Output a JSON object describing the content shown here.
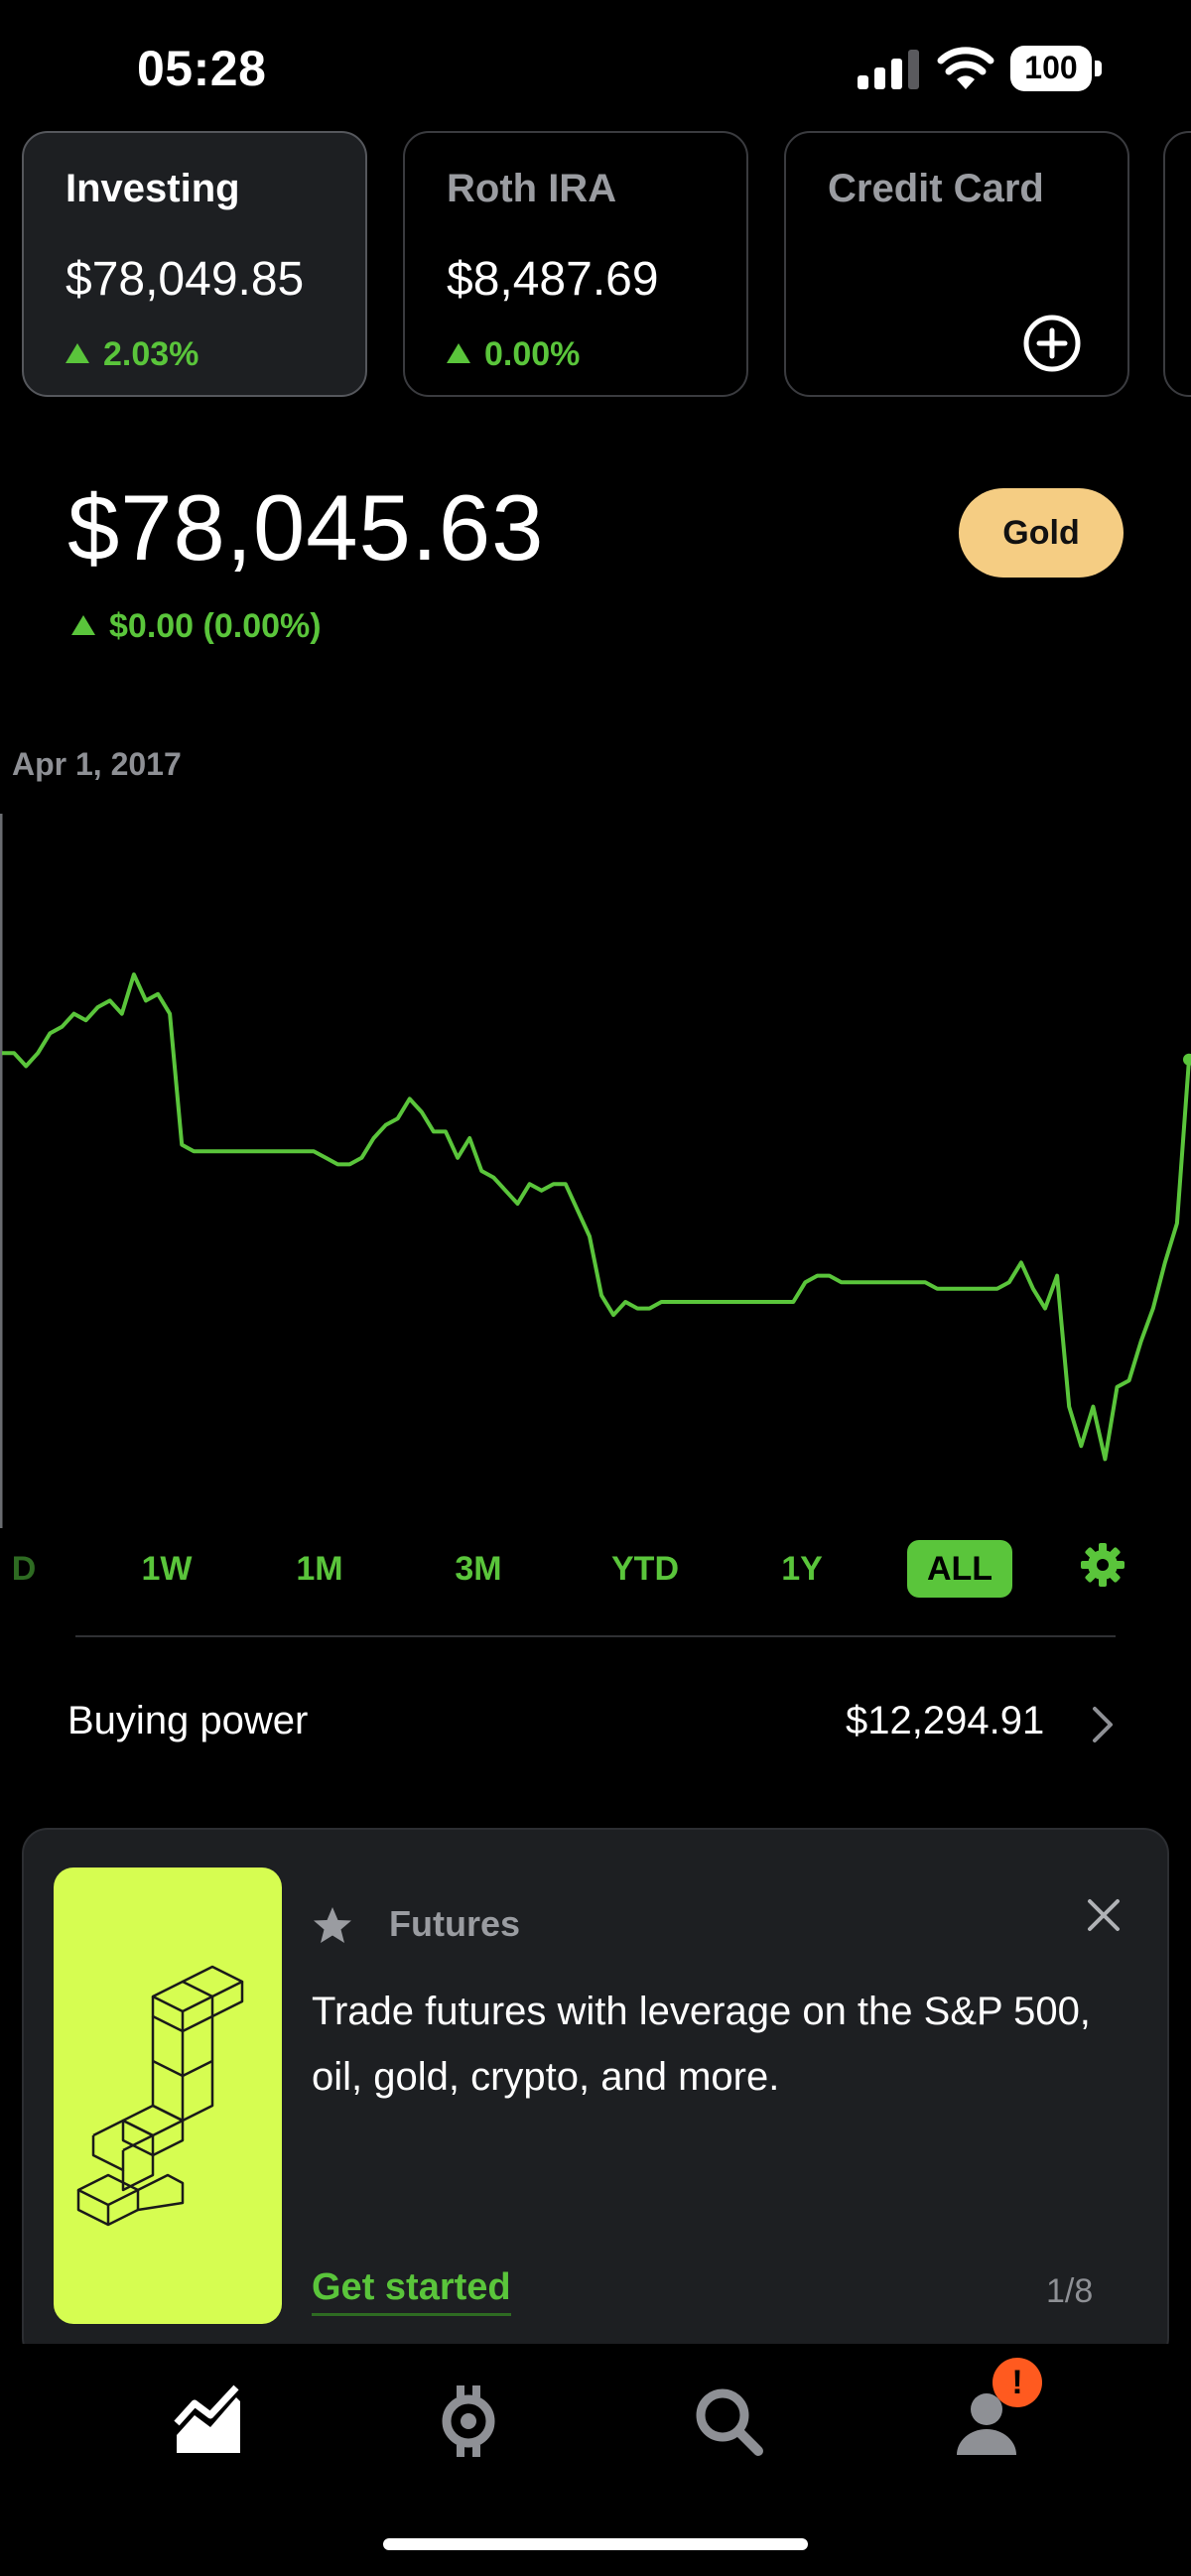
{
  "status_bar": {
    "time": "05:28",
    "battery": "100"
  },
  "accounts": [
    {
      "name": "Investing",
      "value": "$78,049.85",
      "change": "2.03%",
      "active": true
    },
    {
      "name": "Roth IRA",
      "value": "$8,487.69",
      "change": "0.00%",
      "active": false
    },
    {
      "name": "Credit Card",
      "value": "",
      "change": "",
      "active": false
    }
  ],
  "portfolio": {
    "value": "$78,045.63",
    "change": "$0.00 (0.00%)",
    "gold_label": "Gold",
    "chart_date": "Apr 1, 2017"
  },
  "colors": {
    "accent": "#5ac53b",
    "gold": "#f5cd83",
    "promo_art": "#d6fd51",
    "background": "#000000"
  },
  "chart_data": {
    "type": "line",
    "title": "",
    "start_label": "Apr 1, 2017",
    "ylim": [
      0,
      100
    ],
    "series": [
      {
        "name": "",
        "values": [
          68,
          68,
          66,
          68,
          71,
          72,
          74,
          73,
          75,
          76,
          74,
          80,
          76,
          77,
          74,
          54,
          53,
          53,
          53,
          53,
          53,
          53,
          53,
          53,
          53,
          53,
          53,
          52,
          51,
          51,
          52,
          55,
          57,
          58,
          61,
          59,
          56,
          56,
          52,
          55,
          50,
          49,
          47,
          45,
          48,
          47,
          48,
          48,
          44,
          40,
          31,
          28,
          30,
          29,
          29,
          30,
          30,
          30,
          30,
          30,
          30,
          30,
          30,
          30,
          30,
          30,
          30,
          33,
          34,
          34,
          33,
          33,
          33,
          33,
          33,
          33,
          33,
          33,
          32,
          32,
          32,
          32,
          32,
          32,
          33,
          36,
          32,
          29,
          34,
          14,
          8,
          14,
          6,
          17,
          18,
          24,
          29,
          36,
          42,
          67
        ],
        "color": "#5ac53b"
      }
    ]
  },
  "ranges": {
    "items": [
      "D",
      "1W",
      "1M",
      "3M",
      "YTD",
      "1Y",
      "ALL"
    ],
    "active": "ALL"
  },
  "buying_power": {
    "label": "Buying power",
    "value": "$12,294.91"
  },
  "promo": {
    "category": "Futures",
    "body": "Trade futures with leverage on the S&P 500, oil, gold, crypto, and more.",
    "cta": "Get started",
    "pager": "1/8"
  },
  "nav": {
    "items": [
      "chart-icon",
      "crypto-icon",
      "search-icon",
      "account-icon"
    ],
    "badge": "!"
  }
}
